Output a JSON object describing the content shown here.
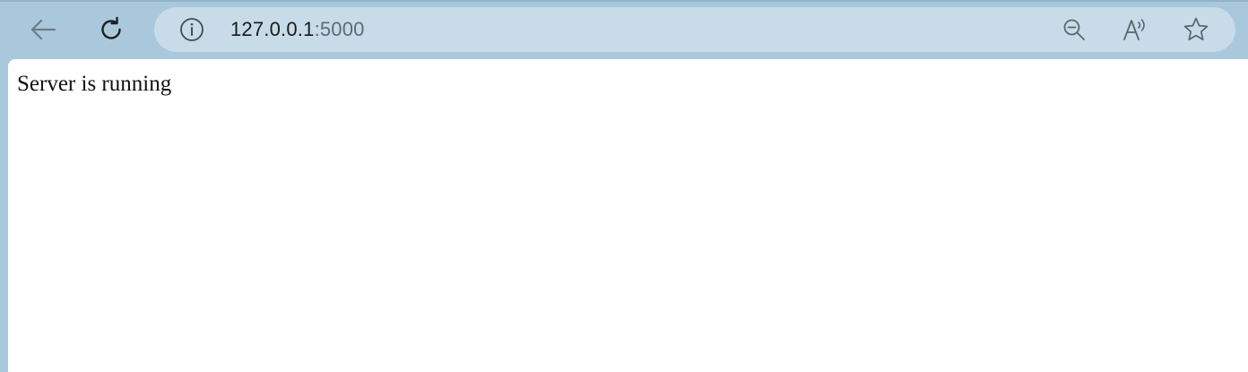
{
  "browser": {
    "url_host": "127.0.0.1",
    "url_port": ":5000",
    "icons": {
      "back": "back-arrow-icon",
      "refresh": "refresh-icon",
      "info": "info-icon",
      "zoom": "zoom-out-icon",
      "read_aloud": "read-aloud-icon",
      "favorite": "favorite-star-icon"
    },
    "colors": {
      "frame": "#a9c8dc",
      "address_bar": "#c7dce8",
      "page_background": "#ffffff"
    }
  },
  "page": {
    "body_text": "Server is running"
  }
}
